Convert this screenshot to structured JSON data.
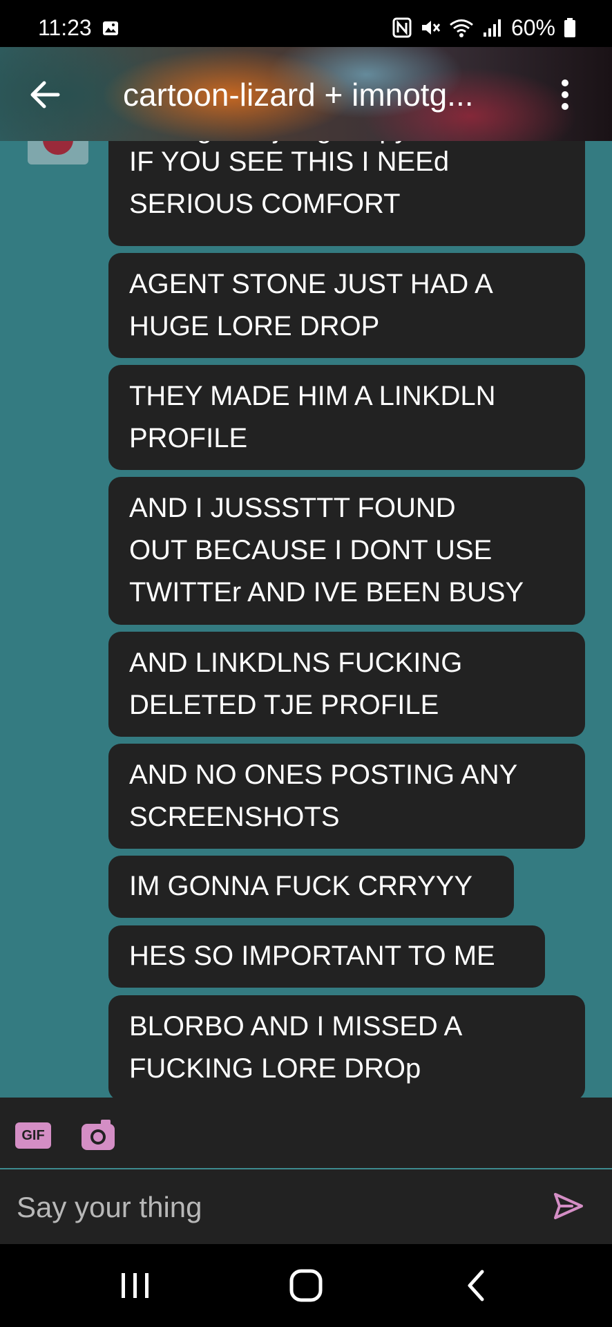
{
  "status_bar": {
    "time": "11:23",
    "battery": "60%",
    "icons": [
      "image-icon",
      "nfc-icon",
      "mute-icon",
      "wifi-icon",
      "signal-icon",
      "battery-icon"
    ]
  },
  "header": {
    "title": "cartoon-lizard + imnotg...",
    "back_icon": "arrow-left-icon",
    "more_icon": "more-vertical-icon"
  },
  "chat": {
    "cut_off_text": "imnotgrimmjustgrumpy/rea...",
    "messages": [
      {
        "lines": [
          "IF YOU SEE THIS I NEEd",
          "SERIOUS COMFORT"
        ]
      },
      {
        "lines": [
          "AGENT STONE JUST HAD A",
          "HUGE LORE DROP"
        ]
      },
      {
        "lines": [
          "THEY MADE HIM A LINKDLN",
          "PROFILE"
        ]
      },
      {
        "lines": [
          "AND I JUSSSTTT FOUND",
          "OUT BECAUSE I DONT USE",
          "TWITTEr AND IVE BEEN BUSY"
        ]
      },
      {
        "lines": [
          "AND LINKDLNS FUCKING",
          "DELETED TJE PROFILE"
        ]
      },
      {
        "lines": [
          "AND NO ONES POSTING ANY",
          "SCREENSHOTS"
        ]
      },
      {
        "lines": [
          "IM GONNA FUCK CRRYYY"
        ]
      },
      {
        "lines": [
          "HES SO IMPORTANT TO ME"
        ]
      },
      {
        "lines": [
          "BLORBO AND I MISSED A",
          "FUCKING LORE DROp"
        ]
      }
    ]
  },
  "toolbar": {
    "gif_label": "GIF",
    "camera_icon": "camera-icon"
  },
  "composer": {
    "placeholder": "Say your thing",
    "value": "",
    "send_icon": "send-icon"
  },
  "colors": {
    "chat_background": "#347b81",
    "bubble": "#222222",
    "accent_pink": "#d48ec5"
  },
  "nav_bar": {
    "icons": [
      "recents-icon",
      "home-icon",
      "back-icon"
    ]
  }
}
